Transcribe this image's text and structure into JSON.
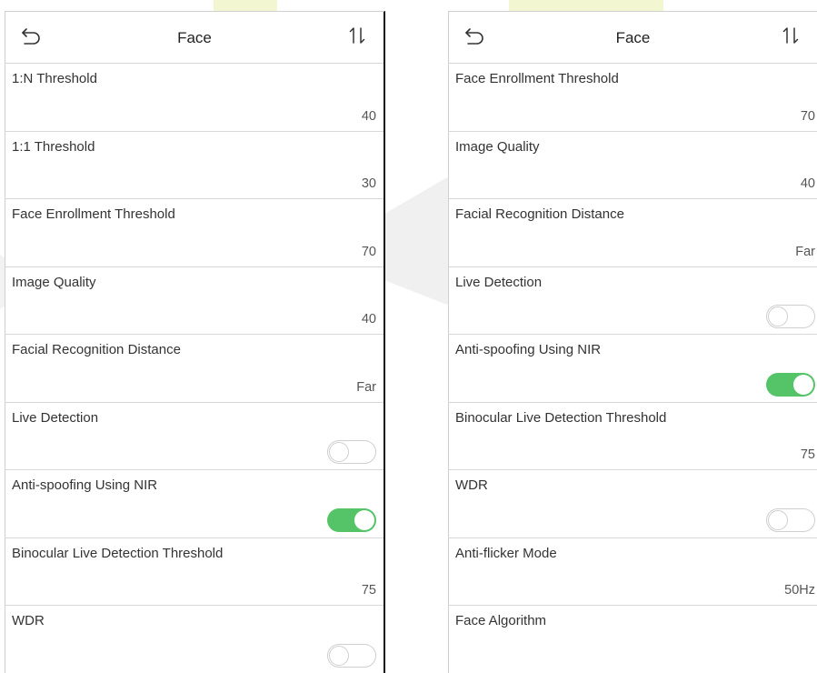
{
  "colors": {
    "toggle_on": "#55c468",
    "divider": "#d8d8d8",
    "text": "#333333"
  },
  "left_screen": {
    "header": {
      "back_icon": "back-arrow-icon",
      "title": "Face",
      "sort_icon": "sort-arrows-icon"
    },
    "items": [
      {
        "label": "1:N Threshold",
        "value": "40"
      },
      {
        "label": "1:1 Threshold",
        "value": "30"
      },
      {
        "label": "Face Enrollment Threshold",
        "value": "70"
      },
      {
        "label": "Image Quality",
        "value": "40"
      },
      {
        "label": "Facial Recognition Distance",
        "value": "Far"
      },
      {
        "label": "Live Detection",
        "toggle": false
      },
      {
        "label": "Anti-spoofing Using NIR",
        "toggle": true
      },
      {
        "label": "Binocular Live Detection Threshold",
        "value": "75"
      },
      {
        "label": "WDR",
        "toggle": false
      }
    ]
  },
  "right_screen": {
    "header": {
      "back_icon": "back-arrow-icon",
      "title": "Face",
      "sort_icon": "sort-arrows-icon"
    },
    "items": [
      {
        "label": "Face Enrollment Threshold",
        "value": "70"
      },
      {
        "label": "Image Quality",
        "value": "40"
      },
      {
        "label": "Facial Recognition Distance",
        "value": "Far"
      },
      {
        "label": "Live Detection",
        "toggle": false
      },
      {
        "label": "Anti-spoofing Using NIR",
        "toggle": true
      },
      {
        "label": "Binocular Live Detection Threshold",
        "value": "75"
      },
      {
        "label": "WDR",
        "toggle": false
      },
      {
        "label": "Anti-flicker Mode",
        "value": "50Hz"
      },
      {
        "label": "Face Algorithm"
      }
    ]
  }
}
